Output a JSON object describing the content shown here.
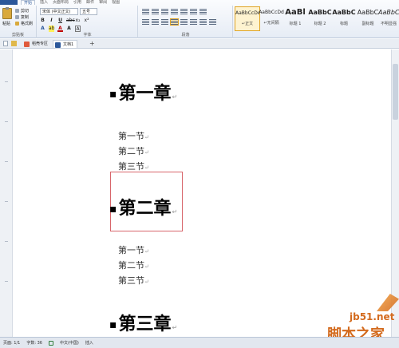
{
  "ribbon": {
    "tabs": [
      "开始",
      "插入",
      "页面布局",
      "引用",
      "邮件",
      "审阅",
      "视图"
    ],
    "active_tab": "开始",
    "clipboard": {
      "paste_label": "粘贴",
      "cut_label": "剪切",
      "copy_label": "复制",
      "format_painter_label": "格式刷",
      "group_label": "剪贴板"
    },
    "font": {
      "font_name": "宋体 (中文正文)",
      "font_size": "五号",
      "group_label": "字体"
    },
    "paragraph": {
      "group_label": "段落"
    },
    "styles": {
      "items": [
        {
          "preview": "AaBbCcDd",
          "name": "↵正文",
          "selected": true
        },
        {
          "preview": "AaBbCcDd",
          "name": "↵无间隔",
          "selected": false
        },
        {
          "preview": "AaBl",
          "name": "标题 1",
          "selected": false
        },
        {
          "preview": "AaBbC",
          "name": "标题 2",
          "selected": false
        },
        {
          "preview": "AaBbC",
          "name": "标题",
          "selected": false
        },
        {
          "preview": "AaBbC",
          "name": "副标题",
          "selected": false
        },
        {
          "preview": "AaBbC",
          "name": "不明显强",
          "selected": false
        }
      ]
    }
  },
  "doc_tabs": [
    {
      "label": "稻壳专区",
      "icon": "daoke-icon"
    },
    {
      "label": "文档1",
      "icon": "word-doc-icon"
    }
  ],
  "document": {
    "chapters": [
      {
        "title": "第一章",
        "sections": [
          "第一节",
          "第二节",
          "第三节"
        ]
      },
      {
        "title": "第二章",
        "sections": [
          "第一节",
          "第二节",
          "第三节"
        ]
      },
      {
        "title": "第三章",
        "sections": []
      }
    ],
    "paragraph_mark": "↵"
  },
  "status_bar": {
    "page": "页面: 1/1",
    "words": "字数: 36",
    "language": "中文(中国)",
    "mode": "插入"
  },
  "watermark": {
    "domain": "jb51.net",
    "text": "脚本之家"
  }
}
